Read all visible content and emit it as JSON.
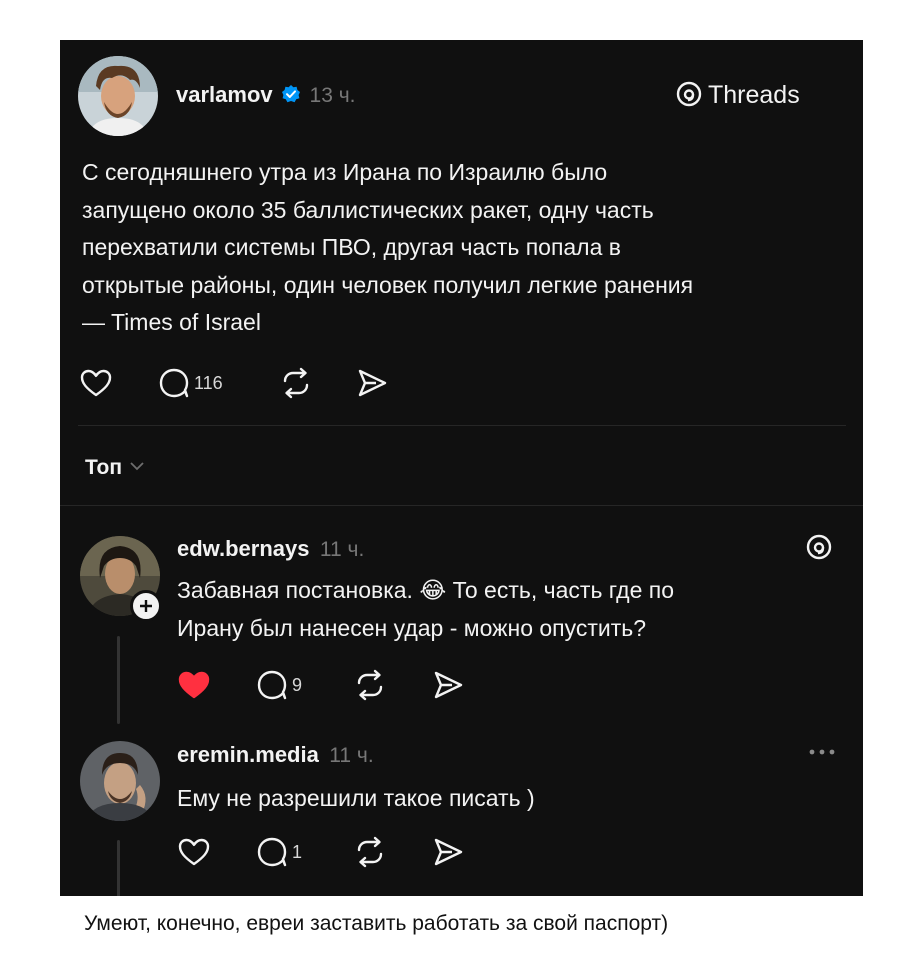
{
  "post": {
    "username": "varlamov",
    "time": "13 ч.",
    "brand": "Threads",
    "text_lines": [
      "С сегодняшнего утра из Ирана по Израилю было",
      "запущено около 35 баллистических ракет, одну часть",
      "перехватили системы ПВО, другая часть попала в",
      "открытые районы, один человек получил легкие ранения",
      "— Times of Israel"
    ],
    "reply_count": "116",
    "verified_color": "#0095f6"
  },
  "sort": {
    "label": "Топ"
  },
  "replies": [
    {
      "username": "edw.bernays",
      "time": "11 ч.",
      "text_lines": [
        "Забавная постановка. 😂 То есть, часть где по",
        "Ирану был нанесен удар - можно опустить?"
      ],
      "reply_count": "9",
      "liked": true,
      "like_color": "#ff3040"
    },
    {
      "username": "eremin.media",
      "time": "11 ч.",
      "text_lines": [
        "Ему не разрешили такое писать )"
      ],
      "reply_count": "1",
      "liked": false
    }
  ],
  "caption": "Умеют, конечно, евреи заставить работать за свой паспорт)"
}
